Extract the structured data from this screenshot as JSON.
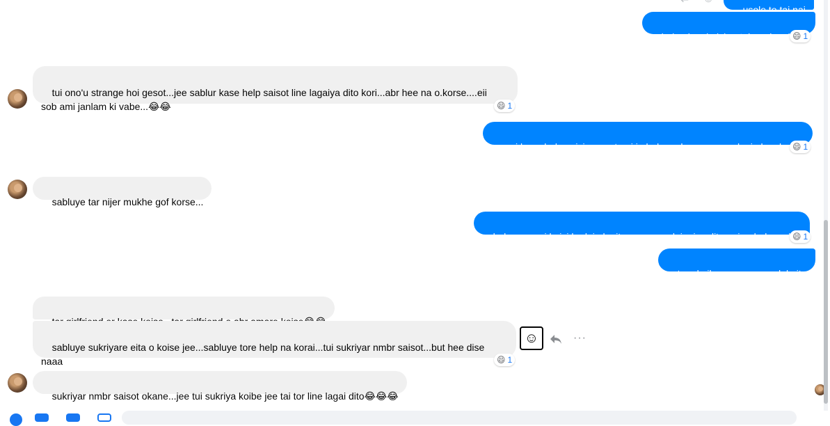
{
  "messages": [
    {
      "id": "m0",
      "dir": "out",
      "text": "usole to tai nai"
    },
    {
      "id": "m1",
      "dir": "out",
      "text": "hala akan koisi ar tui are kan kore",
      "reaction": {
        "emoji": "😄",
        "count": "1"
      }
    },
    {
      "id": "m2",
      "dir": "in",
      "text": "tui ono'u strange hoi gesot...jee sablur kase help saisot line lagaiya dito kori...abr hee na o.korse....eii\nsob ami janlam ki vabe...😂😂",
      "reaction": {
        "emoji": "😄",
        "count": "1"
      }
    },
    {
      "id": "m3",
      "dir": "out",
      "text": "ami kuno help caici na .....tumi je bukacuda ........     ar lagi okan bujso",
      "reaction": {
        "emoji": "😄",
        "count": "1"
      }
    },
    {
      "id": "m4",
      "dir": "in",
      "text": "sabluye tar nijer mukhe gof korse..."
    },
    {
      "id": "m5",
      "dir": "out",
      "text": "haha .....ami koisi he lain lagito .....amere laigaiya dito nai re bukacuda .",
      "reaction": {
        "emoji": "😄",
        "count": "1"
      }
    },
    {
      "id": "m6",
      "dir": "out",
      "text": "tare koile na massage dekaito"
    },
    {
      "id": "m7",
      "dir": "in",
      "text": "tar girlfriend er kase koise...tar girlfriend e abr amare koise😂😂"
    },
    {
      "id": "m8",
      "dir": "in",
      "text": "sabluye sukriyare eita o koise jee...sabluye tore help na korai...tui sukriyar nmbr saisot...but hee dise\nnaaa",
      "reaction": {
        "emoji": "😄",
        "count": "1"
      }
    },
    {
      "id": "m9",
      "dir": "in",
      "text": "sukriyar nmbr saisot okane...jee tui sukriya koibe jee tai tor line lagai dito😂😂😂"
    }
  ],
  "hover_actions": {
    "react_icon": "smiley-face-icon",
    "react_glyph": "☺",
    "reply_icon": "reply-arrow-icon",
    "more_icon": "more-horizontal-icon",
    "more_glyph": "···"
  },
  "colors": {
    "outgoing": "#0084ff",
    "incoming": "#f0f0f0",
    "reaction_count": "#1877f2"
  }
}
